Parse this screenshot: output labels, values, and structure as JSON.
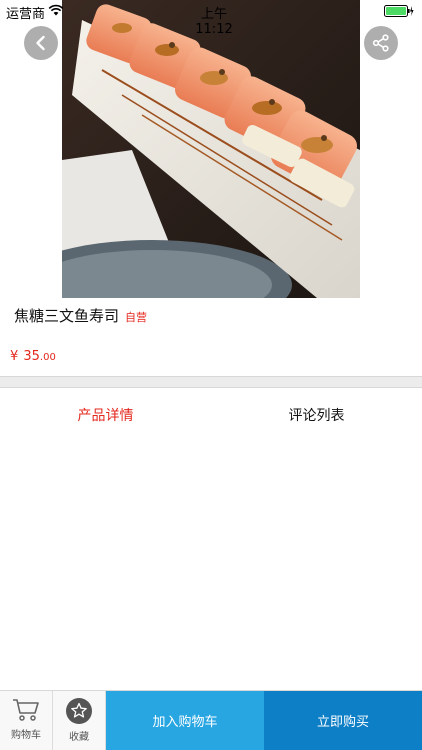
{
  "status_bar": {
    "carrier": "运营商",
    "time": "上午11:12"
  },
  "product": {
    "name": "焦糖三文鱼寿司",
    "badge": "自营",
    "price_currency": "¥",
    "price_integer": "35",
    "price_decimal": ".00"
  },
  "tabs": [
    {
      "label": "产品详情",
      "active": true
    },
    {
      "label": "评论列表",
      "active": false
    }
  ],
  "bottom_bar": {
    "cart_label": "购物车",
    "favorite_label": "收藏",
    "add_to_cart_label": "加入购物车",
    "buy_now_label": "立即购买"
  },
  "colors": {
    "accent_red": "#e4271d",
    "add_cart_blue": "#27a6e2",
    "buy_now_blue": "#0d7fc6"
  },
  "icons": {
    "back": "chevron-left-icon",
    "share": "share-icon",
    "cart": "cart-icon",
    "favorite": "star-icon"
  }
}
